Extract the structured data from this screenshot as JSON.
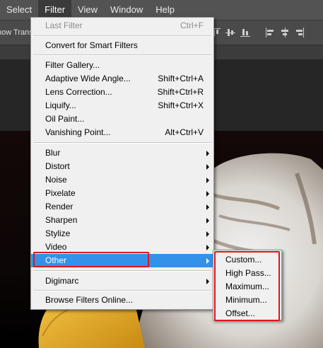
{
  "menubar": {
    "items": [
      "Select",
      "Filter",
      "View",
      "Window",
      "Help"
    ],
    "active_index": 1
  },
  "optionsbar": {
    "show_transform_label": "how Trans"
  },
  "filter_menu": {
    "items": [
      {
        "label": "Last Filter",
        "shortcut": "Ctrl+F",
        "disabled": true
      },
      {
        "label": "Convert for Smart Filters"
      },
      {
        "label": "Filter Gallery..."
      },
      {
        "label": "Adaptive Wide Angle...",
        "shortcut": "Shift+Ctrl+A"
      },
      {
        "label": "Lens Correction...",
        "shortcut": "Shift+Ctrl+R"
      },
      {
        "label": "Liquify...",
        "shortcut": "Shift+Ctrl+X"
      },
      {
        "label": "Oil Paint..."
      },
      {
        "label": "Vanishing Point...",
        "shortcut": "Alt+Ctrl+V"
      },
      {
        "label": "Blur",
        "submenu": true
      },
      {
        "label": "Distort",
        "submenu": true
      },
      {
        "label": "Noise",
        "submenu": true
      },
      {
        "label": "Pixelate",
        "submenu": true
      },
      {
        "label": "Render",
        "submenu": true
      },
      {
        "label": "Sharpen",
        "submenu": true
      },
      {
        "label": "Stylize",
        "submenu": true
      },
      {
        "label": "Video",
        "submenu": true
      },
      {
        "label": "Other",
        "submenu": true,
        "highlighted": true
      },
      {
        "label": "Digimarc",
        "submenu": true
      },
      {
        "label": "Browse Filters Online..."
      }
    ]
  },
  "other_submenu": {
    "items": [
      "Custom...",
      "High Pass...",
      "Maximum...",
      "Minimum...",
      "Offset..."
    ]
  },
  "colors": {
    "highlight": "#3391e9",
    "annotation_red": "#e0151b",
    "menubar_bg": "#535353"
  }
}
